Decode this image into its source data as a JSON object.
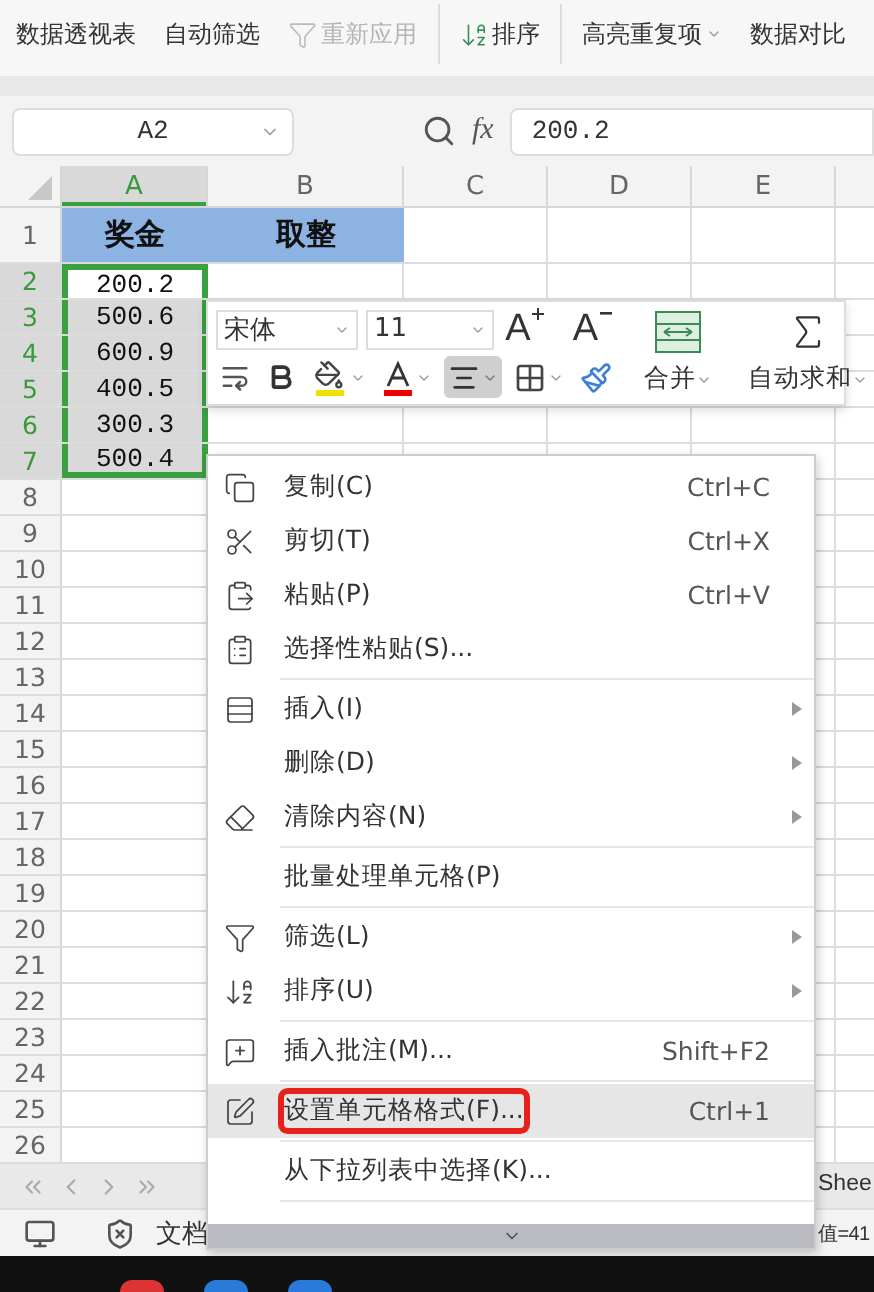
{
  "ribbon": [
    {
      "label": "数据透视表",
      "disabled": false
    },
    {
      "label": "自动筛选",
      "disabled": false
    },
    {
      "label": "重新应用",
      "disabled": true
    },
    {
      "label": "排序",
      "disabled": false
    },
    {
      "label": "高亮重复项",
      "disabled": false,
      "dropdown": true
    },
    {
      "label": "数据对比",
      "disabled": false
    }
  ],
  "name_box": "A2",
  "formula_label": "fx",
  "formula": "200.2",
  "columns": [
    {
      "label": "A",
      "selected": true
    },
    {
      "label": "B",
      "selected": false
    },
    {
      "label": "C",
      "selected": false
    },
    {
      "label": "D",
      "selected": false
    },
    {
      "label": "E",
      "selected": false
    }
  ],
  "rows": [
    {
      "number": "1",
      "selected": false,
      "header": true,
      "cells": [
        {
          "text": "奖金",
          "selected": false,
          "active": false
        },
        {
          "text": "取整",
          "selected": false,
          "active": false
        }
      ]
    },
    {
      "number": "2",
      "selected": true,
      "cells": [
        {
          "text": "200.2",
          "selected": true,
          "active": true
        }
      ]
    },
    {
      "number": "3",
      "selected": true,
      "cells": [
        {
          "text": "500.6",
          "selected": true,
          "active": false
        }
      ]
    },
    {
      "number": "4",
      "selected": true,
      "cells": [
        {
          "text": "600.9",
          "selected": true,
          "active": false
        }
      ]
    },
    {
      "number": "5",
      "selected": true,
      "cells": [
        {
          "text": "400.5",
          "selected": true,
          "active": false
        }
      ]
    },
    {
      "number": "6",
      "selected": true,
      "cells": [
        {
          "text": "300.3",
          "selected": true,
          "active": false
        }
      ]
    },
    {
      "number": "7",
      "selected": true,
      "cells": [
        {
          "text": "500.4",
          "selected": true,
          "active": false
        }
      ]
    },
    {
      "number": "8",
      "selected": false
    },
    {
      "number": "9",
      "selected": false
    },
    {
      "number": "10",
      "selected": false
    },
    {
      "number": "11",
      "selected": false
    },
    {
      "number": "12",
      "selected": false
    },
    {
      "number": "13",
      "selected": false
    },
    {
      "number": "14",
      "selected": false
    },
    {
      "number": "15",
      "selected": false
    },
    {
      "number": "16",
      "selected": false
    },
    {
      "number": "17",
      "selected": false
    },
    {
      "number": "18",
      "selected": false
    },
    {
      "number": "19",
      "selected": false
    },
    {
      "number": "20",
      "selected": false
    },
    {
      "number": "21",
      "selected": false
    },
    {
      "number": "22",
      "selected": false
    },
    {
      "number": "23",
      "selected": false
    },
    {
      "number": "24",
      "selected": false
    },
    {
      "number": "25",
      "selected": false
    },
    {
      "number": "26",
      "selected": false
    }
  ],
  "mini_toolbar": {
    "font": "宋体",
    "size": "11",
    "grow_font": "A",
    "shrink_font": "A",
    "merge": "合并",
    "autosum": "自动求和",
    "align_center_selected": true
  },
  "menu": [
    {
      "kind": "item",
      "label": "复制(C)",
      "shortcut": "Ctrl+C",
      "submenu": false,
      "highlighted": false
    },
    {
      "kind": "item",
      "label": "剪切(T)",
      "shortcut": "Ctrl+X",
      "submenu": false,
      "highlighted": false
    },
    {
      "kind": "item",
      "label": "粘贴(P)",
      "shortcut": "Ctrl+V",
      "submenu": false,
      "highlighted": false
    },
    {
      "kind": "item",
      "label": "选择性粘贴(S)...",
      "submenu": false,
      "highlighted": false
    },
    {
      "kind": "separator"
    },
    {
      "kind": "item",
      "label": "插入(I)",
      "submenu": true,
      "highlighted": false
    },
    {
      "kind": "item",
      "label": "删除(D)",
      "submenu": true,
      "highlighted": false
    },
    {
      "kind": "item",
      "label": "清除内容(N)",
      "submenu": true,
      "highlighted": false
    },
    {
      "kind": "separator"
    },
    {
      "kind": "item",
      "label": "批量处理单元格(P)",
      "submenu": false,
      "highlighted": false
    },
    {
      "kind": "separator"
    },
    {
      "kind": "item",
      "label": "筛选(L)",
      "submenu": true,
      "highlighted": false
    },
    {
      "kind": "item",
      "label": "排序(U)",
      "submenu": true,
      "highlighted": false
    },
    {
      "kind": "separator"
    },
    {
      "kind": "item",
      "label": "插入批注(M)...",
      "shortcut": "Shift+F2",
      "submenu": false,
      "highlighted": false
    },
    {
      "kind": "separator"
    },
    {
      "kind": "item",
      "label": "设置单元格格式(F)...",
      "shortcut": "Ctrl+1",
      "submenu": false,
      "highlighted": true,
      "annotated": true
    },
    {
      "kind": "separator"
    },
    {
      "kind": "item",
      "label": "从下拉列表中选择(K)...",
      "submenu": false,
      "highlighted": false
    },
    {
      "kind": "separator"
    }
  ],
  "sheet_tab": "Shee",
  "status": {
    "document": "文档",
    "summary": "值=41"
  }
}
